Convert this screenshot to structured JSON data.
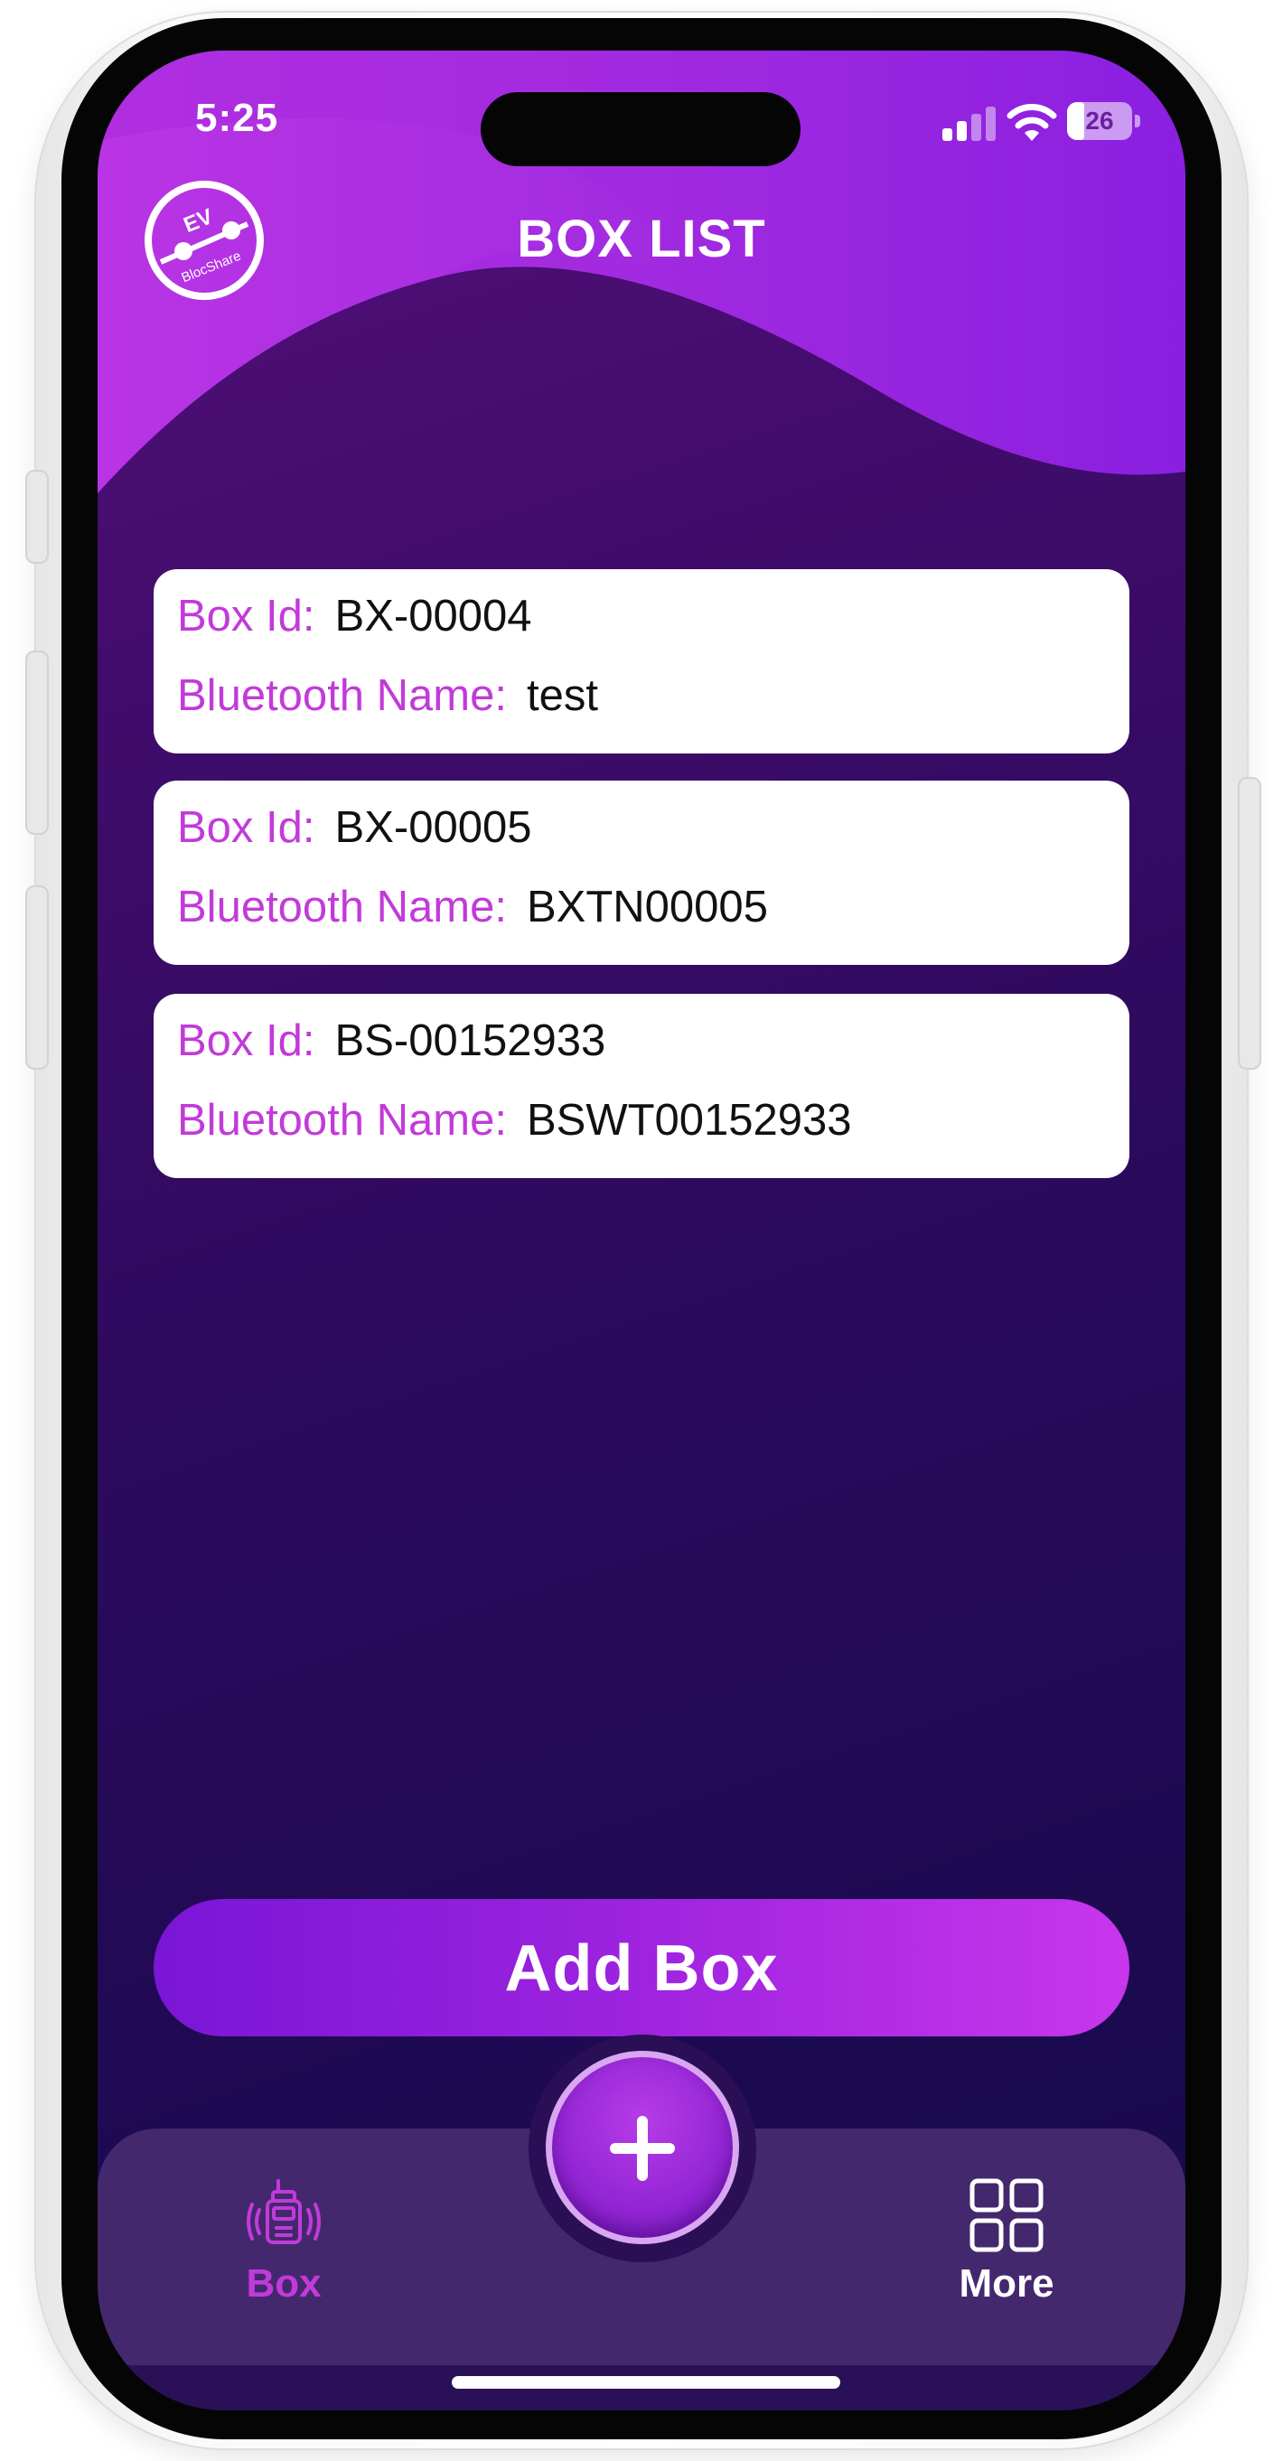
{
  "status_bar": {
    "time": "5:25",
    "battery": "26"
  },
  "header": {
    "title": "BOX LIST",
    "logo_text_top": "EV",
    "logo_text_bottom": "BlocShare"
  },
  "boxes": [
    {
      "id_label": "Box Id:",
      "id_value": "BX-00004",
      "bt_label": "Bluetooth Name:",
      "bt_value": "test"
    },
    {
      "id_label": "Box Id:",
      "id_value": "BX-00005",
      "bt_label": "Bluetooth Name:",
      "bt_value": "BXTN00005"
    },
    {
      "id_label": "Box Id:",
      "id_value": "BS-00152933",
      "bt_label": "Bluetooth Name:",
      "bt_value": "BSWT00152933"
    }
  ],
  "actions": {
    "add_box_label": "Add Box"
  },
  "bottom_nav": {
    "items": [
      {
        "label": "Box",
        "icon": "robot-icon",
        "active": true
      },
      {
        "label": "More",
        "icon": "grid-icon",
        "active": false
      }
    ],
    "center_icon": "plus-icon"
  },
  "colors": {
    "accent": "#c23ad9",
    "nav_active": "#c23ad9",
    "nav_inactive": "#ffffff",
    "button_gradient_start": "#7a16d6",
    "button_gradient_end": "#c836ec"
  }
}
